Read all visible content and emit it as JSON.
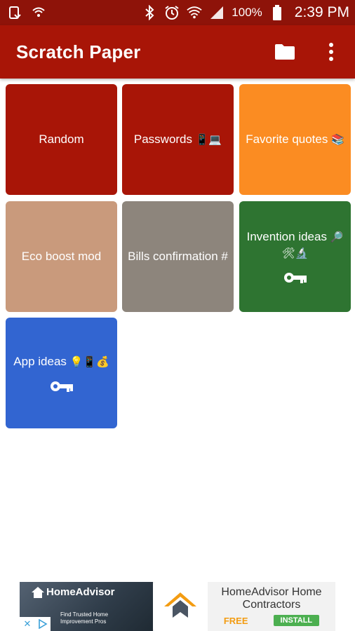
{
  "status_bar": {
    "battery_text": "100%",
    "time": "2:39 PM",
    "icons": [
      "screenshot-icon",
      "wifi-small-icon",
      "bluetooth-icon",
      "alarm-icon",
      "wifi-icon",
      "signal-icon",
      "battery-icon"
    ]
  },
  "app_bar": {
    "title": "Scratch Paper",
    "actions": [
      "folder-icon",
      "more-vert-icon"
    ],
    "color": "#a81507"
  },
  "tiles": [
    {
      "label": "Random",
      "emoji": "",
      "color": "#a81507",
      "locked": false
    },
    {
      "label": "Passwords",
      "emoji": "📱💻",
      "color": "#a81507",
      "locked": false
    },
    {
      "label": "Favorite quotes",
      "emoji": "📚",
      "color": "#fb8c22",
      "locked": false
    },
    {
      "label": "Eco boost mod",
      "emoji": "",
      "color": "#c99a7c",
      "locked": false
    },
    {
      "label": "Bills confirmation #",
      "emoji": "",
      "color": "#8d857c",
      "locked": false
    },
    {
      "label": "Invention ideas",
      "emoji": "🔎🛠🔬",
      "color": "#2e7431",
      "locked": true
    },
    {
      "label": "App ideas",
      "emoji": "💡📱💰",
      "color": "#3265d1",
      "locked": true
    }
  ],
  "ad": {
    "brand": "HomeAdvisor",
    "tagline": "Find Trusted Home Improvement Pros",
    "title": "HomeAdvisor Home Contractors",
    "price": "FREE",
    "cta": "INSTALL",
    "close": "✕"
  }
}
